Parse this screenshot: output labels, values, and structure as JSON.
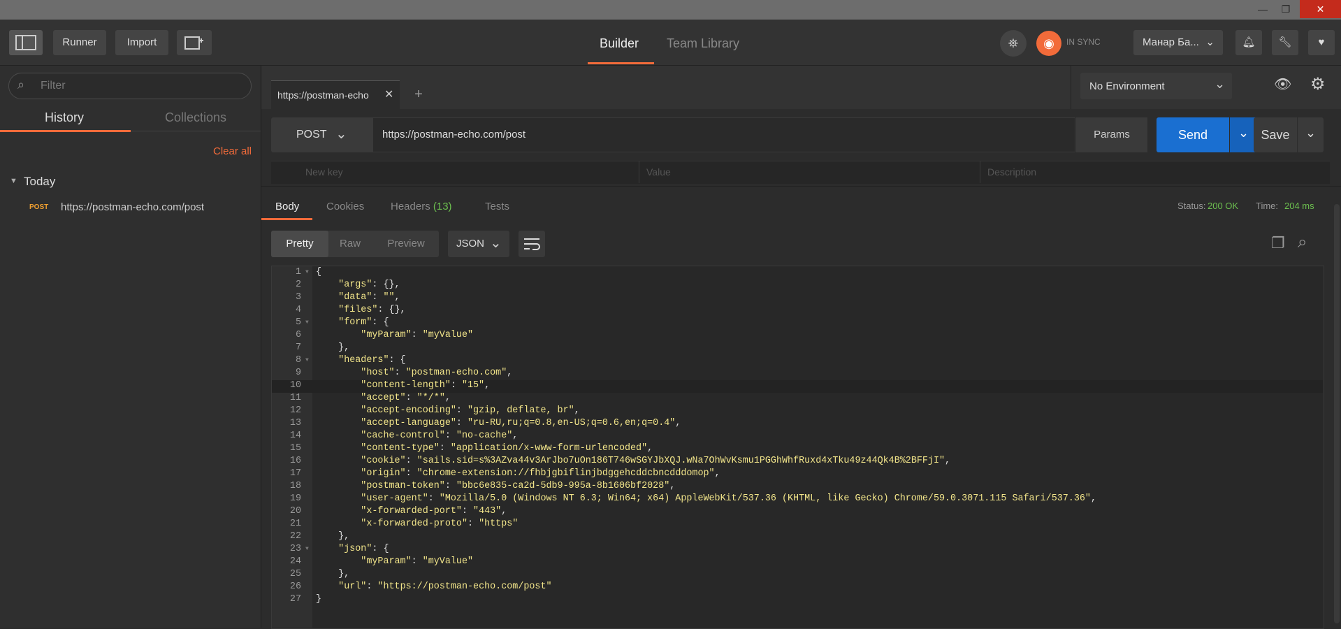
{
  "header": {
    "runner_label": "Runner",
    "import_label": "Import",
    "tabs": [
      "Builder",
      "Team Library"
    ],
    "sync_label": "IN SYNC",
    "user_label": "Манар Ба...",
    "accent": "#f26b3a"
  },
  "sidebar": {
    "filter_placeholder": "Filter",
    "tabs": [
      "History",
      "Collections"
    ],
    "clear_all": "Clear all",
    "group": "Today",
    "items": [
      {
        "method": "POST",
        "url": "https://postman-echo.com/post"
      }
    ]
  },
  "request": {
    "tab_label": "https://postman-echo",
    "environment": "No Environment",
    "method": "POST",
    "url": "https://postman-echo.com/post",
    "params_label": "Params",
    "send_label": "Send",
    "save_label": "Save",
    "kv_placeholders": [
      "New key",
      "Value",
      "Description"
    ]
  },
  "response": {
    "tabs": {
      "body": "Body",
      "cookies": "Cookies",
      "headers": "Headers",
      "headers_count": "(13)",
      "tests": "Tests"
    },
    "status_label": "Status:",
    "status_value": "200 OK",
    "time_label": "Time:",
    "time_value": "204 ms",
    "view_modes": [
      "Pretty",
      "Raw",
      "Preview"
    ],
    "format": "JSON",
    "lines": [
      "{",
      "    \"args\": {},",
      "    \"data\": \"\",",
      "    \"files\": {},",
      "    \"form\": {",
      "        \"myParam\": \"myValue\"",
      "    },",
      "    \"headers\": {",
      "        \"host\": \"postman-echo.com\",",
      "        \"content-length\": \"15\",",
      "        \"accept\": \"*/*\",",
      "        \"accept-encoding\": \"gzip, deflate, br\",",
      "        \"accept-language\": \"ru-RU,ru;q=0.8,en-US;q=0.6,en;q=0.4\",",
      "        \"cache-control\": \"no-cache\",",
      "        \"content-type\": \"application/x-www-form-urlencoded\",",
      "        \"cookie\": \"sails.sid=s%3AZva44v3ArJbo7uOn186T746wSGYJbXQJ.wNa7OhWvKsmu1PGGhWhfRuxd4xTku49z44Qk4B%2BFFjI\",",
      "        \"origin\": \"chrome-extension://fhbjgbiflinjbdggehcddcbncdddomop\",",
      "        \"postman-token\": \"bbc6e835-ca2d-5db9-995a-8b1606bf2028\",",
      "        \"user-agent\": \"Mozilla/5.0 (Windows NT 6.3; Win64; x64) AppleWebKit/537.36 (KHTML, like Gecko) Chrome/59.0.3071.115 Safari/537.36\",",
      "        \"x-forwarded-port\": \"443\",",
      "        \"x-forwarded-proto\": \"https\"",
      "    },",
      "    \"json\": {",
      "        \"myParam\": \"myValue\"",
      "    },",
      "    \"url\": \"https://postman-echo.com/post\"",
      "}"
    ]
  }
}
